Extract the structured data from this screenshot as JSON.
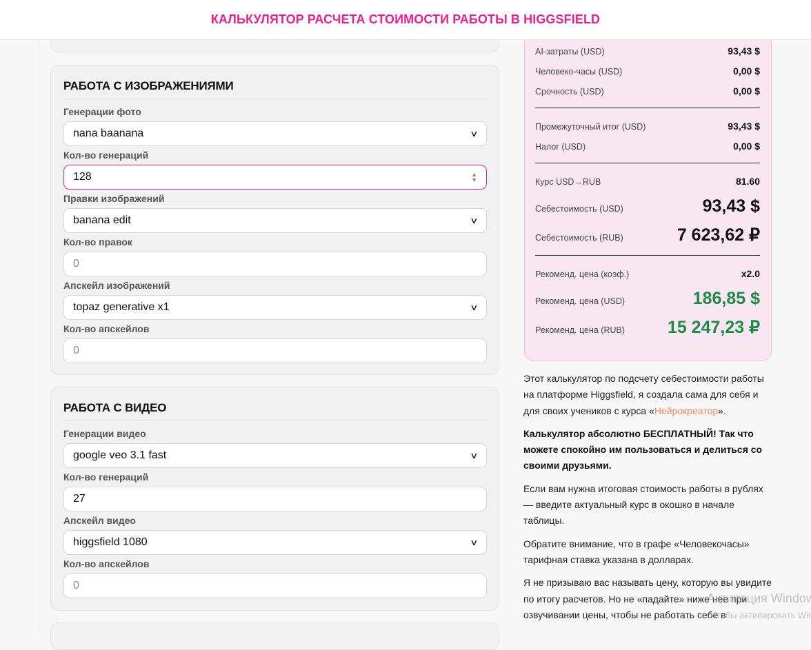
{
  "header": {
    "title": "КАЛЬКУЛЯТОР РАСЧЕТА СТОИМОСТИ РАБОТЫ В HIGGSFIELD"
  },
  "images": {
    "title": "РАБОТА С ИЗОБРАЖЕНИЯМИ",
    "fields": [
      {
        "label": "Генерации фото",
        "type": "select",
        "value": "nana baanana"
      },
      {
        "label": "Кол-во генераций",
        "type": "number",
        "value": "128"
      },
      {
        "label": "Правки изображений",
        "type": "select",
        "value": "banana edit"
      },
      {
        "label": "Кол-во правок",
        "type": "number",
        "placeholder": "0"
      },
      {
        "label": "Апскейл изображений",
        "type": "select",
        "value": "topaz generative x1"
      },
      {
        "label": "Кол-во апскейлов",
        "type": "number",
        "placeholder": "0"
      }
    ]
  },
  "video": {
    "title": "РАБОТА С ВИДЕО",
    "fields": [
      {
        "label": "Генерации видео",
        "type": "select",
        "value": "google veo 3.1 fast"
      },
      {
        "label": "Кол-во генераций",
        "type": "number",
        "value": "27"
      },
      {
        "label": "Апскейл видео",
        "type": "select",
        "value": "higgsfield 1080"
      },
      {
        "label": "Кол-во апскейлов",
        "type": "number",
        "placeholder": "0"
      }
    ]
  },
  "summary": {
    "ai": {
      "label": "AI-затраты (USD)",
      "value": "93,43 $"
    },
    "hours": {
      "label": "Человеко-часы (USD)",
      "value": "0,00 $"
    },
    "urgency": {
      "label": "Срочность (USD)",
      "value": "0,00 $"
    },
    "subtotal": {
      "label": "Промежуточный итог (USD)",
      "value": "93,43 $"
    },
    "tax": {
      "label": "Налог (USD)",
      "value": "0,00 $"
    },
    "rate": {
      "label": "Курс USD→RUB",
      "value": "81.60"
    },
    "cost_usd": {
      "label": "Себестоимость (USD)",
      "value": "93,43 $"
    },
    "cost_rub": {
      "label": "Себестоимость (RUB)",
      "value": "7 623,62 ₽"
    },
    "coef": {
      "label": "Рекоменд. цена (коэф.)",
      "value": "x2.0"
    },
    "price_usd": {
      "label": "Рекоменд. цена (USD)",
      "value": "186,85 $"
    },
    "price_rub": {
      "label": "Рекоменд. цена (RUB)",
      "value": "15 247,23 ₽"
    }
  },
  "text": {
    "p1a": "Этот калькулятор по подсчету себестоимости работы на платформе Higgsfield, я создала сама для себя и для своих учеников с курса «",
    "p1link": "Нейрокреатор",
    "p1b": "».",
    "p2": "Калькулятор абсолютно БЕСПЛАТНЫЙ! Так что можете спокойно им пользоваться и делиться со своими друзьями.",
    "p3": "Если вам нужна итоговая стоимость работы в рублях — введите актуальный курс в окошко в начале таблицы.",
    "p4": "Обратите внимание, что в графе «Человекочасы» тарифная ставка указана в долларах.",
    "p5": "Я не призываю вас называть цену, которую вы увидите по итогу расчетов. Но не «падайте» ниже нее при озвучивании цены, чтобы не работать себе в"
  },
  "watermark": {
    "line1": "Активация Windows",
    "line2": "Чтобы активировать Windows"
  },
  "colors": {
    "accent": "#ec1f8e",
    "green": "#1e8a4a",
    "link": "#f4845f"
  }
}
